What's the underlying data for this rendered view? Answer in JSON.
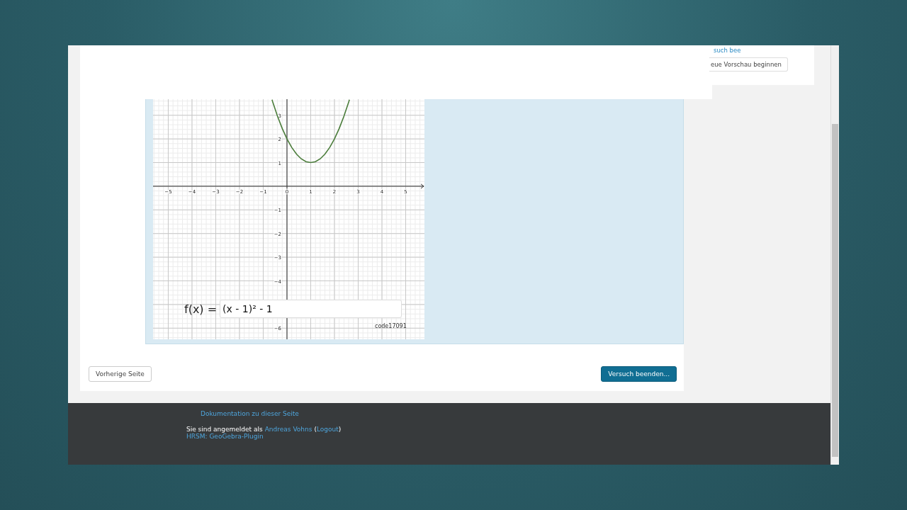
{
  "sidebar": {
    "link": "such bee",
    "button": "eue Vorschau beginnen"
  },
  "question": {
    "graph": {
      "chart_data": {
        "type": "line",
        "x": [
          -0.63,
          -0.6,
          -0.4,
          -0.2,
          0,
          0.2,
          0.4,
          0.6,
          0.8,
          1,
          1.2,
          1.4,
          1.6,
          1.8,
          2,
          2.2,
          2.4,
          2.6,
          2.63
        ],
        "series": [
          {
            "color": "#4a7c3a",
            "values": [
              3.66,
              3.56,
              2.96,
              2.44,
              2,
              1.64,
              1.36,
              1.16,
              1.04,
              1,
              1.04,
              1.16,
              1.36,
              1.64,
              2,
              2.44,
              2.96,
              3.56,
              3.66
            ]
          }
        ],
        "grid": true,
        "xlim": [
          -5.64,
          5.79
        ],
        "ylim": [
          -6.47,
          3.68
        ],
        "xticks": [
          -5,
          -4,
          -3,
          -2,
          -1,
          0,
          1,
          2,
          3,
          4,
          5
        ],
        "yticks": [
          -6,
          -4,
          -3,
          -2,
          -1,
          1,
          2,
          3
        ]
      },
      "formula_label": "f(x) =",
      "formula_value": "(x - 1)² - 1",
      "code": "code17091"
    }
  },
  "nav": {
    "previous": "Vorherige Seite",
    "finish": "Versuch beenden..."
  },
  "footer": {
    "doc_link": "Dokumentation zu dieser Seite",
    "login_prefix": "Sie sind angemeldet als",
    "user": "Andreas Vohns",
    "paren_open": "(",
    "logout": "Logout",
    "paren_close": ")",
    "plugin_link": "HRSM: GeoGebra-Plugin"
  }
}
